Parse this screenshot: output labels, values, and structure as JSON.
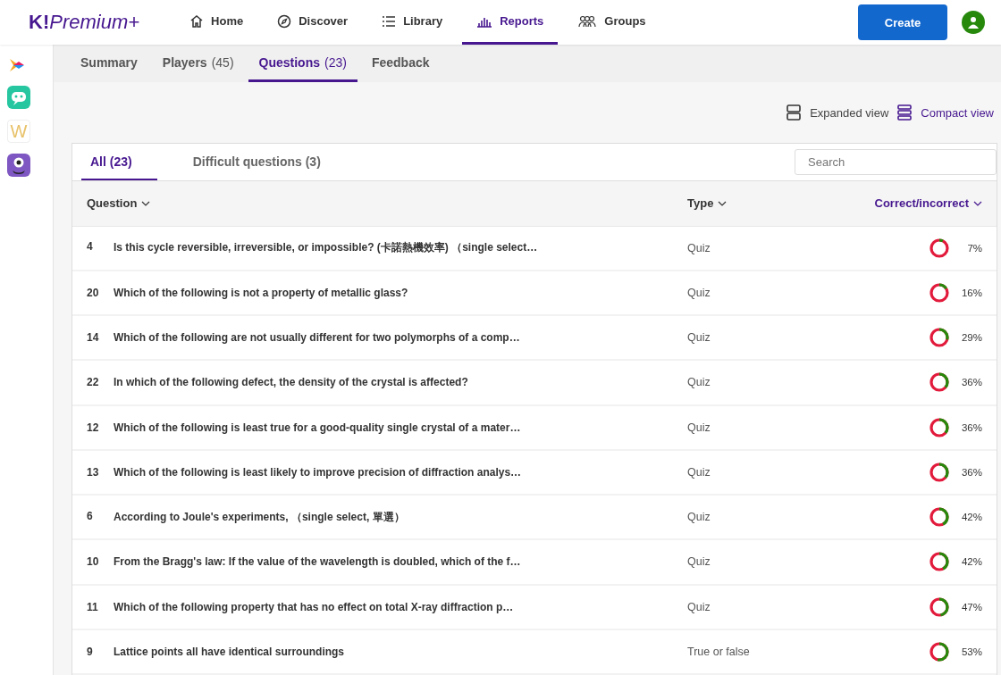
{
  "topnav": {
    "logo": {
      "mark": "K!",
      "text": "Premium+"
    },
    "items": [
      {
        "label": "Home",
        "kind": "home",
        "selected": false
      },
      {
        "label": "Discover",
        "kind": "compass",
        "selected": false
      },
      {
        "label": "Library",
        "kind": "list",
        "selected": false
      },
      {
        "label": "Reports",
        "kind": "bars",
        "selected": true
      },
      {
        "label": "Groups",
        "kind": "people",
        "selected": false
      }
    ],
    "create_button": "Create"
  },
  "sidebar_apps": [
    {
      "kind": "arrow"
    },
    {
      "kind": "robot"
    },
    {
      "kind": "letter",
      "label": "W"
    },
    {
      "kind": "monster"
    }
  ],
  "report_tabs": [
    {
      "label": "Summary",
      "selected": false
    },
    {
      "label": "Players",
      "count": "(45)",
      "selected": false
    },
    {
      "label": "Questions",
      "count": "(23)",
      "selected": true
    },
    {
      "label": "Feedback",
      "selected": false
    }
  ],
  "views": [
    {
      "label": "Expanded view",
      "kind": "expanded",
      "selected": false
    },
    {
      "label": "Compact view",
      "kind": "compact",
      "selected": true
    }
  ],
  "filter_tabs": [
    {
      "label": "All (23)",
      "selected": true
    },
    {
      "label": "Difficult questions (3)",
      "selected": false
    }
  ],
  "search": {
    "placeholder": "Search"
  },
  "table": {
    "columns": [
      {
        "label": "Question",
        "sorted": false
      },
      {
        "label": "Type",
        "sorted": false
      },
      {
        "label": "Correct/incorrect",
        "sorted": true
      }
    ],
    "rows": [
      {
        "number": "4",
        "question": "Is this cycle reversible, irreversible, or impossible? (卡諾熱機效率) （single select…",
        "type": "Quiz",
        "percent": "7%"
      },
      {
        "number": "20",
        "question": "Which of the following is not a property of metallic glass?",
        "type": "Quiz",
        "percent": "16%"
      },
      {
        "number": "14",
        "question": "Which of the following are not usually different for two polymorphs of a comp…",
        "type": "Quiz",
        "percent": "29%"
      },
      {
        "number": "22",
        "question": "In which of the following defect, the density of the crystal is affected?",
        "type": "Quiz",
        "percent": "36%"
      },
      {
        "number": "12",
        "question": "Which of the following is least true for a good-quality single crystal of a mater…",
        "type": "Quiz",
        "percent": "36%"
      },
      {
        "number": "13",
        "question": "Which of the following is least likely to improve precision of diffraction analys…",
        "type": "Quiz",
        "percent": "36%"
      },
      {
        "number": "6",
        "question": "According to Joule's experiments, （single select, 單選）",
        "type": "Quiz",
        "percent": "42%"
      },
      {
        "number": "10",
        "question": "From the Bragg's law: If the value of the wavelength is doubled, which of the f…",
        "type": "Quiz",
        "percent": "42%"
      },
      {
        "number": "11",
        "question": "Which of the following property that has no effect on total X-ray diffraction p…",
        "type": "Quiz",
        "percent": "47%"
      },
      {
        "number": "9",
        "question": "Lattice points all have identical surroundings",
        "type": "True or false",
        "percent": "53%"
      }
    ]
  }
}
